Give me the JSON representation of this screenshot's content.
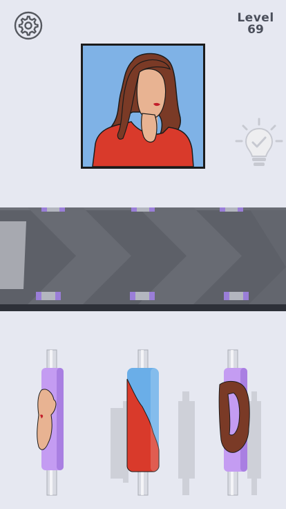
{
  "hud": {
    "settings_icon": "gear-icon",
    "level_word": "Level",
    "level_number": "69",
    "hint_icon": "lightbulb-check-icon"
  },
  "target": {
    "subject": "portrait-woman-brown-hair-red-top",
    "frame_color": "#1b1b1b",
    "background_color": "#7fb2e6"
  },
  "rollers": [
    {
      "id": "roller-left",
      "color": "#c49cf2",
      "pattern": "face-skin"
    },
    {
      "id": "roller-middle",
      "color": "#6aaee8",
      "pattern": "red-shirt"
    },
    {
      "id": "roller-right",
      "color": "#c49cf2",
      "pattern": "brown-hair"
    }
  ],
  "colors": {
    "background": "#e6e8f1",
    "belt": "#5d6068",
    "belt_edge": "#2d3038",
    "roller_purple": "#c49cf2",
    "roller_blue": "#6aaee8",
    "shirt_red": "#d93a2b",
    "hair_brown": "#7a3a26",
    "skin": "#e8b392"
  }
}
